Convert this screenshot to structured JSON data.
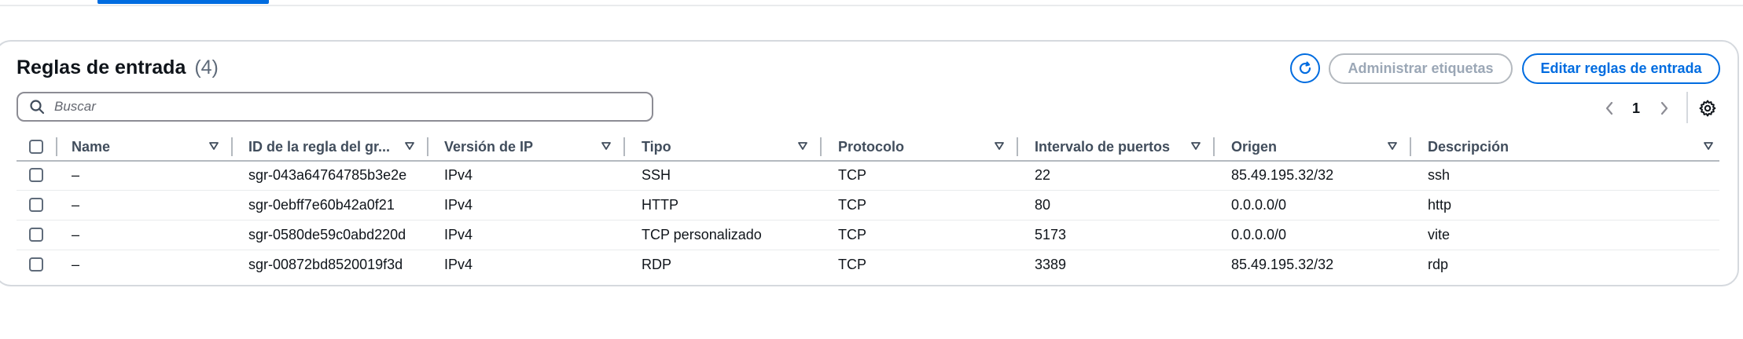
{
  "section": {
    "title": "Reglas de entrada",
    "count": "(4)"
  },
  "actions": {
    "manage_tags_label": "Administrar etiquetas",
    "edit_rules_label": "Editar reglas de entrada"
  },
  "search": {
    "placeholder": "Buscar"
  },
  "pagination": {
    "current_page": "1"
  },
  "table": {
    "columns": [
      "Name",
      "ID de la regla del gr...",
      "Versión de IP",
      "Tipo",
      "Protocolo",
      "Intervalo de puertos",
      "Origen",
      "Descripción"
    ],
    "rows": [
      {
        "name": "–",
        "rule_id": "sgr-043a64764785b3e2e",
        "ip_version": "IPv4",
        "type": "SSH",
        "protocol": "TCP",
        "port_range": "22",
        "source": "85.49.195.32/32",
        "description": "ssh"
      },
      {
        "name": "–",
        "rule_id": "sgr-0ebff7e60b42a0f21",
        "ip_version": "IPv4",
        "type": "HTTP",
        "protocol": "TCP",
        "port_range": "80",
        "source": "0.0.0.0/0",
        "description": "http"
      },
      {
        "name": "–",
        "rule_id": "sgr-0580de59c0abd220d",
        "ip_version": "IPv4",
        "type": "TCP personalizado",
        "protocol": "TCP",
        "port_range": "5173",
        "source": "0.0.0.0/0",
        "description": "vite"
      },
      {
        "name": "–",
        "rule_id": "sgr-00872bd8520019f3d",
        "ip_version": "IPv4",
        "type": "RDP",
        "protocol": "TCP",
        "port_range": "3389",
        "source": "85.49.195.32/32",
        "description": "rdp"
      }
    ]
  },
  "icons": {
    "refresh": "refresh-icon",
    "search": "search-icon",
    "prev": "chevron-left-icon",
    "next": "chevron-right-icon",
    "settings": "gear-icon",
    "sort": "sort-down-triangle-icon"
  },
  "colors": {
    "accent": "#006ce0",
    "disabled": "#9ba7b6",
    "text": "#0f141a",
    "header_text": "#414d5c"
  }
}
